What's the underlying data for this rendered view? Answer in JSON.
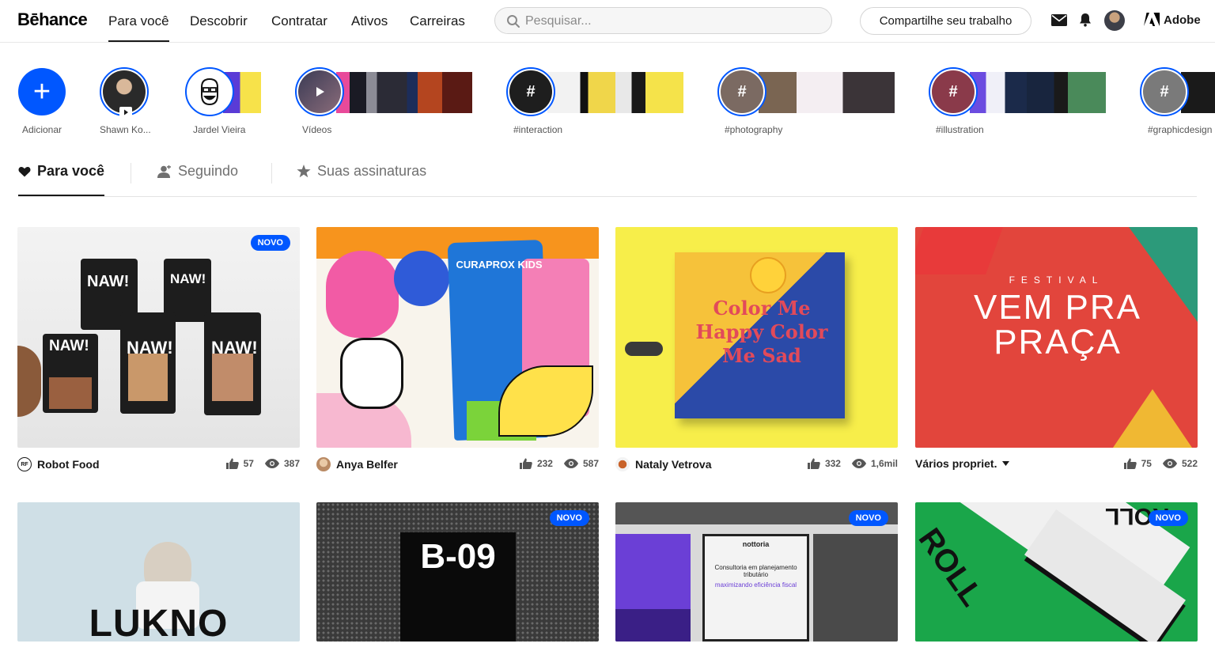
{
  "header": {
    "logo": "Bēhance",
    "nav": [
      "Para você",
      "Descobrir",
      "Contratar",
      "Ativos",
      "Carreiras"
    ],
    "search_placeholder": "Pesquisar...",
    "share_button": "Compartilhe seu trabalho",
    "adobe_label": "Adobe"
  },
  "stories": {
    "add_label": "Adicionar",
    "items": [
      {
        "label": "Shawn Ko..."
      },
      {
        "label": "Jardel Vieira"
      },
      {
        "label": "Vídeos"
      },
      {
        "label": "#interaction"
      },
      {
        "label": "#photography"
      },
      {
        "label": "#illustration"
      },
      {
        "label": "#graphicdesign"
      }
    ]
  },
  "tabs": [
    "Para você",
    "Seguindo",
    "Suas assinaturas"
  ],
  "cards_row1": [
    {
      "owner": "Robot Food",
      "likes": "57",
      "views": "387",
      "badge": "NOVO",
      "thumb_text": "NAW!"
    },
    {
      "owner": "Anya Belfer",
      "likes": "232",
      "views": "587",
      "badge": "",
      "thumb_text": "CURAPROX KIDS"
    },
    {
      "owner": "Nataly Vetrova",
      "likes": "332",
      "views": "1,6mil",
      "badge": "",
      "thumb_text": "Color Me Happy Color Me Sad"
    },
    {
      "owner": "Vários propriet.",
      "likes": "75",
      "views": "522",
      "badge": "",
      "thumb_text": "VEM PRA PRAÇA",
      "thumb_subtext": "FESTIVAL"
    }
  ],
  "cards_row2": [
    {
      "badge": "",
      "thumb_text": "LUKNO"
    },
    {
      "badge": "NOVO",
      "thumb_text": "B-09"
    },
    {
      "badge": "NOVO",
      "thumb_text": "nottoria",
      "thumb_subtext": "Consultoria em planejamento tributário",
      "thumb_subtext2": "maximizando eficiência fiscal"
    },
    {
      "badge": "NOVO",
      "thumb_text": "ROLL"
    }
  ],
  "colors": {
    "accent": "#0057ff",
    "text": "#191919",
    "muted": "#707070"
  }
}
